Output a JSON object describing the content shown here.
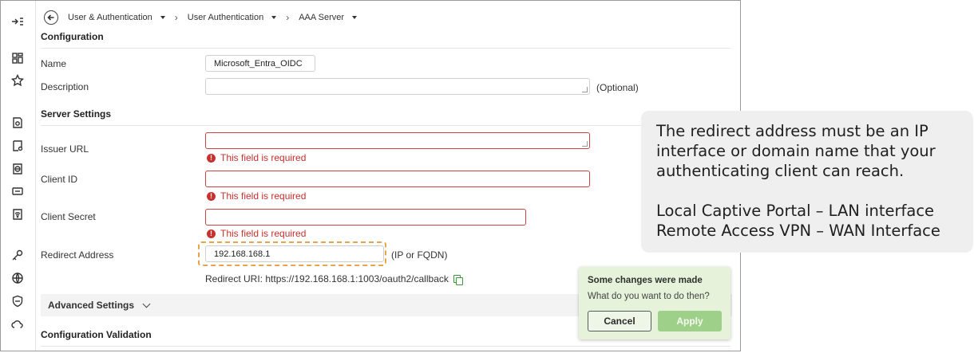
{
  "breadcrumbs": [
    {
      "label": "User & Authentication"
    },
    {
      "label": "User Authentication"
    },
    {
      "label": "AAA Server"
    }
  ],
  "sections": {
    "configuration": "Configuration",
    "server_settings": "Server Settings",
    "advanced_settings": "Advanced Settings",
    "configuration_validation": "Configuration Validation"
  },
  "fields": {
    "name": {
      "label": "Name",
      "value": "Microsoft_Entra_OIDC"
    },
    "description": {
      "label": "Description",
      "value": "",
      "hint": "(Optional)"
    },
    "issuer_url": {
      "label": "Issuer URL",
      "value": "",
      "error": "This field is required"
    },
    "client_id": {
      "label": "Client ID",
      "value": "",
      "error": "This field is required"
    },
    "client_secret": {
      "label": "Client Secret",
      "value": "",
      "error": "This field is required"
    },
    "redirect_address": {
      "label": "Redirect Address",
      "value": "192.168.168.1",
      "hint": "(IP or FQDN)"
    }
  },
  "redirect_uri": "Redirect URI: https://192.168.168.1:1003/oauth2/callback",
  "callout": {
    "line1": "The redirect address must be an IP\ninterface or domain name that your\nauthenticating client can reach.",
    "line2": "Local Captive Portal – LAN interface\nRemote Access VPN – WAN Interface"
  },
  "popup": {
    "title": "Some changes were made",
    "text": "What do you want to do then?",
    "cancel": "Cancel",
    "apply": "Apply"
  },
  "colors": {
    "error": "#c8312d",
    "highlight": "#e8a44a",
    "popup_bg": "#e6f3da",
    "apply_bg": "#9fd08a"
  },
  "sidebar_icons": [
    "collapse-icon",
    "dashboard-icon",
    "star-icon",
    "settings-doc-icon",
    "certificate-icon",
    "globe-doc-icon",
    "vpn-icon",
    "wifi-icon",
    "key-icon",
    "globe-icon",
    "shield-icon",
    "cloud-icon"
  ]
}
